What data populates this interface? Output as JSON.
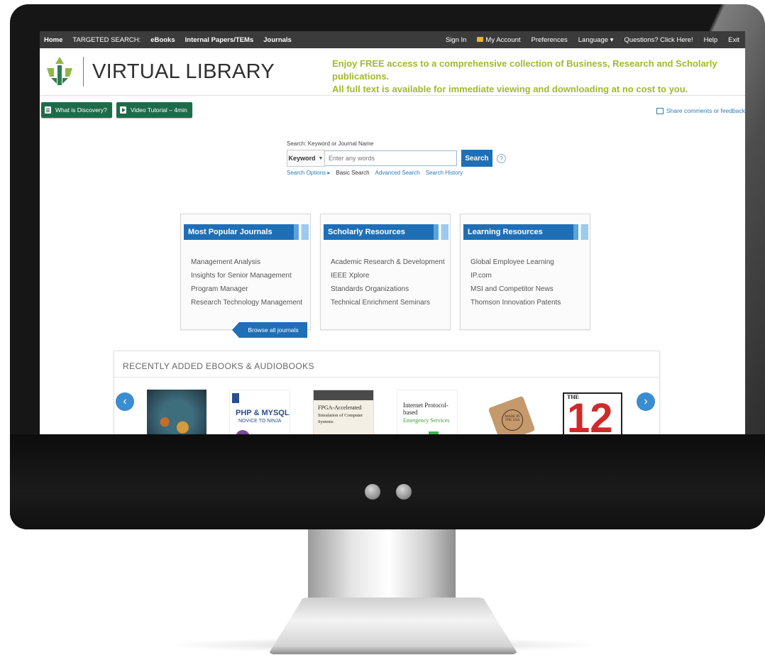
{
  "topnav": {
    "left": [
      "Home",
      "TARGETED SEARCH:",
      "eBooks",
      "Internal Papers/TEMs",
      "Journals"
    ],
    "right": {
      "sign_in": "Sign In",
      "my_account": "My Account",
      "preferences": "Preferences",
      "language": "Language ▾",
      "questions": "Questions? Click Here!",
      "help": "Help",
      "exit": "Exit"
    }
  },
  "brand": {
    "title": "VIRTUAL LIBRARY",
    "tagline_line1": "Enjoy FREE access to a comprehensive collection of Business, Research and Scholarly publications.",
    "tagline_line2": "All full text is available for immediate viewing and downloading at no cost to you."
  },
  "buttons": {
    "what_is_discovery": "What is Discovery?",
    "video_tutorial": "Video Tutorial – 4min",
    "share": "Share comments or feedback"
  },
  "search": {
    "label": "Search: Keyword or Journal Name",
    "select_value": "Keyword",
    "placeholder": "Enter any words",
    "button": "Search",
    "help": "?",
    "links": {
      "options": "Search Options ▸",
      "basic": "Basic Search",
      "advanced": "Advanced Search",
      "history": "Search History"
    }
  },
  "cards": [
    {
      "title": "Most Popular Journals",
      "items": [
        "Management Analysis",
        "Insights for Senior Management",
        "Program Manager",
        "Research Technology Management"
      ],
      "action": "Browse all journals"
    },
    {
      "title": "Scholarly Resources",
      "items": [
        "Academic Research & Development",
        "IEEE Xplore",
        "Standards Organizations",
        "Technical Enrichment Seminars"
      ]
    },
    {
      "title": "Learning Resources",
      "items": [
        "Global Employee Learning",
        "IP.com",
        "MSI and Competitor News",
        "Thomson Innovation Patents"
      ]
    }
  ],
  "recent": {
    "title": "RECENTLY ADDED EBOOKS & AUDIOBOOKS",
    "prev": "‹",
    "next": "›",
    "books": [
      {
        "id": "book-1",
        "text": ""
      },
      {
        "id": "book-2",
        "text": "PHP & MYSQL",
        "sub": "NOVICE TO NINJA"
      },
      {
        "id": "book-3",
        "text": "FPGA-Accelerated",
        "sub": "Simulation of Computer Systems"
      },
      {
        "id": "book-4",
        "text": "Internet Protocol-based",
        "sub": "Emergency Services"
      },
      {
        "id": "book-5",
        "text": "MADE IN THE USA"
      },
      {
        "id": "book-6",
        "text": "THE",
        "sub": "12"
      }
    ]
  },
  "colors": {
    "nav_bg": "#3b3b3b",
    "accent_blue": "#1f6fb6",
    "green_button": "#1e6b4a",
    "tagline": "#a3b92a"
  }
}
